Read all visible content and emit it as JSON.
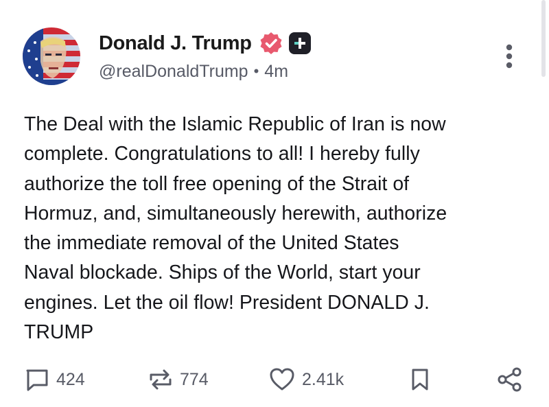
{
  "author": {
    "display_name": "Donald J. Trump",
    "handle": "@realDonaldTrump",
    "separator": "•",
    "timestamp": "4m"
  },
  "post": {
    "text": "The Deal with the Islamic Republic of Iran is now\ncomplete. Congratulations to all! I hereby fully\nauthorize the toll free opening of the Strait of\nHormuz, and, simultaneously herewith, authorize\nthe immediate removal of the United States\nNaval blockade. Ships of the World, start your\nengines. Let the oil flow! President DONALD J.\nTRUMP"
  },
  "actions": {
    "replies": "424",
    "reposts": "774",
    "likes": "2.41k"
  },
  "icons": {
    "verified": "verified-badge-icon",
    "plus": "plus-badge-icon",
    "more": "more-vertical-icon",
    "reply": "reply-icon",
    "repost": "repost-icon",
    "like": "heart-icon",
    "bookmark": "bookmark-icon",
    "share": "share-icon"
  },
  "colors": {
    "verified_badge": "#e8596e",
    "plus_badge": "#1f2028",
    "plus_accent": "#5fd1c3",
    "muted_text": "#575a66"
  }
}
